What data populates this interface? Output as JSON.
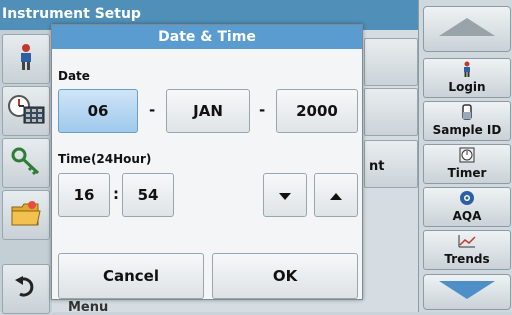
{
  "background": {
    "title": "Instrument Setup",
    "row_partial_label": "nt",
    "bottom_partial_label": "Menu"
  },
  "dialog": {
    "title": "Date & Time",
    "date_label": "Date",
    "day": "06",
    "month": "JAN",
    "year": "2000",
    "date_separator": "-",
    "time_label": "Time(24Hour)",
    "hour": "16",
    "time_separator": ":",
    "minute": "54",
    "cancel_label": "Cancel",
    "ok_label": "OK"
  },
  "sidebar": {
    "items": [
      {
        "label": "Login",
        "icon": "person-icon"
      },
      {
        "label": "Sample ID",
        "icon": "sample-vial-icon"
      },
      {
        "label": "Timer",
        "icon": "timer-icon"
      },
      {
        "label": "AQA",
        "icon": "aqa-icon"
      },
      {
        "label": "Trends",
        "icon": "trends-chart-icon"
      }
    ]
  },
  "colors": {
    "title_bar": "#4f8fb8",
    "dialog_title": "#5a9ccf",
    "selected_field": "#9fc9ec"
  }
}
